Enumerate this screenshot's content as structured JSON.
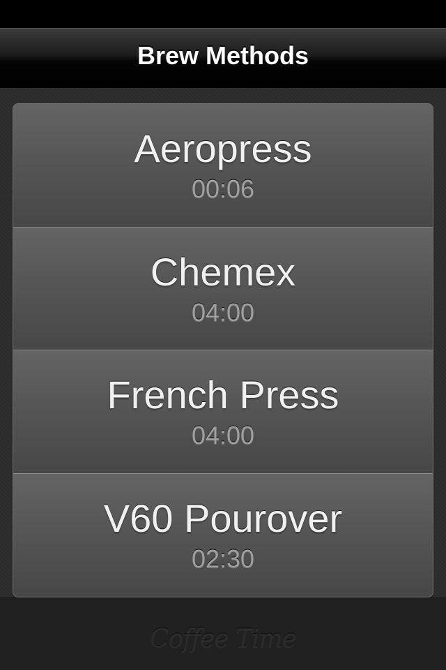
{
  "nav": {
    "title": "Brew Methods"
  },
  "methods": [
    {
      "name": "Aeropress",
      "time": "00:06"
    },
    {
      "name": "Chemex",
      "time": "04:00"
    },
    {
      "name": "French Press",
      "time": "04:00"
    },
    {
      "name": "V60 Pourover",
      "time": "02:30"
    }
  ],
  "footer": {
    "logo_text": "Coffee Time"
  },
  "colors": {
    "nav_background": "#000000",
    "content_background": "#2c2c2c",
    "row_top": "#646464",
    "row_bottom": "#474747",
    "name_text": "#f0f0f0",
    "time_text": "#a0a0a0"
  }
}
